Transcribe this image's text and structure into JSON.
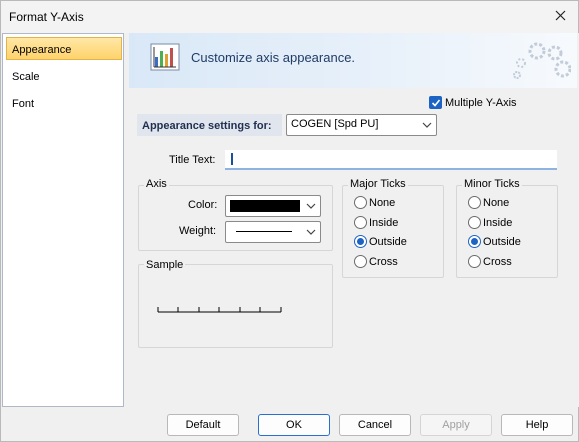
{
  "window": {
    "title": "Format Y-Axis",
    "close_icon": "close-icon"
  },
  "nav": {
    "items": [
      {
        "label": "Appearance",
        "active": true
      },
      {
        "label": "Scale",
        "active": false
      },
      {
        "label": "Font",
        "active": false
      }
    ]
  },
  "banner": {
    "text": "Customize axis appearance.",
    "icon": "chart-icon",
    "decoration": "gears-icon"
  },
  "multiple_y_axis": {
    "label": "Multiple Y-Axis",
    "checked": true
  },
  "appearance_settings": {
    "label": "Appearance settings for:",
    "value": "COGEN [Spd PU]"
  },
  "title_text": {
    "label": "Title Text:",
    "value": ""
  },
  "axis_group": {
    "label": "Axis",
    "color_label": "Color:",
    "color_value": "#000000",
    "weight_label": "Weight:"
  },
  "sample_group": {
    "label": "Sample"
  },
  "major_ticks": {
    "label": "Major Ticks",
    "options": [
      "None",
      "Inside",
      "Outside",
      "Cross"
    ],
    "selected": "Outside"
  },
  "minor_ticks": {
    "label": "Minor Ticks",
    "options": [
      "None",
      "Inside",
      "Outside",
      "Cross"
    ],
    "selected": "Outside"
  },
  "buttons": {
    "default": "Default",
    "ok": "OK",
    "cancel": "Cancel",
    "apply": "Apply",
    "help": "Help"
  },
  "colors": {
    "accent": "#1c63c4",
    "nav_active": "#ffd36b",
    "banner": "#d9e8f7"
  }
}
